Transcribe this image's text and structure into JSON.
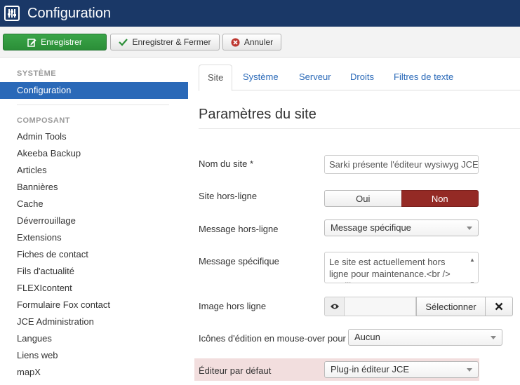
{
  "header": {
    "title": "Configuration",
    "logo_icon": "equalizer-icon"
  },
  "toolbar": {
    "save_label": "Enregistrer",
    "save_close_label": "Enregistrer & Fermer",
    "cancel_label": "Annuler"
  },
  "sidebar": {
    "system_heading": "SYSTÈME",
    "active_item": "Configuration",
    "component_heading": "COMPOSANT",
    "items": [
      "Admin Tools",
      "Akeeba Backup",
      "Articles",
      "Bannières",
      "Cache",
      "Déverrouillage",
      "Extensions",
      "Fiches de contact",
      "Fils d'actualité",
      "FLEXIcontent",
      "Formulaire Fox contact",
      "JCE Administration",
      "Langues",
      "Liens web",
      "mapX"
    ]
  },
  "tabs": [
    "Site",
    "Système",
    "Serveur",
    "Droits",
    "Filtres de texte"
  ],
  "main": {
    "title": "Paramètres du site",
    "site_name_label": "Nom du site *",
    "site_name_value": "Sarki présente l'éditeur wysiwyg JCE",
    "offline_label": "Site hors-ligne",
    "offline_yes": "Oui",
    "offline_no": "Non",
    "offline_message_label": "Message hors-ligne",
    "offline_message_value": "Message spécifique",
    "custom_message_label": "Message spécifique",
    "custom_message_value": "Le site est actuellement hors ligne pour maintenance.<br /> Veuillez",
    "offline_image_label": "Image hors ligne",
    "select_label": "Sélectionner",
    "edit_icons_label": "Icônes d'édition en mouse-over pour",
    "edit_icons_value": "Aucun",
    "default_editor_label": "Éditeur par défaut",
    "default_editor_value": "Plug-in éditeur JCE"
  },
  "colors": {
    "header_bg": "#1a3867",
    "save_green": "#2b8e38",
    "active_blue": "#2a69b8",
    "non_red": "#942a25",
    "highlight": "#f2dede"
  }
}
